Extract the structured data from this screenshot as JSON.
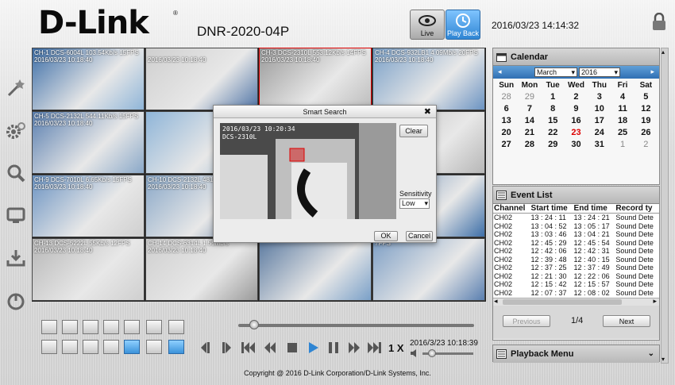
{
  "header": {
    "logo": "D-Link",
    "model": "DNR-2020-04P",
    "live_label": "Live",
    "playback_label": "Play Back",
    "datetime": "2016/03/23 14:14:32"
  },
  "cameras": [
    {
      "caption": "CH-1 DCS-6004L 103.54Kb/s 15FPS",
      "date": "2016/03/23 10:18:40"
    },
    {
      "caption": "",
      "date": "2016/03/23 10:18:40"
    },
    {
      "caption": "CH-3 DCS-2310L 553.12Kb/s 14FPS",
      "date": "2016/03/23 10:18:40"
    },
    {
      "caption": "CH-4 DCS-932LB1 4.09Mb/s 20FPS",
      "date": "2016/03/23 10:18:40"
    },
    {
      "caption": "CH-5 DCS-2132L 544.11Kb/s 15FPS",
      "date": "2016/03/23 10:18:40"
    },
    {
      "caption": "",
      "date": ""
    },
    {
      "caption": "",
      "date": ""
    },
    {
      "caption": "Kb/s 15FPS",
      "date": ""
    },
    {
      "caption": "CH-9 DCS-7010L 6.65Kb/s 15FPS",
      "date": "2016/03/23 10:18:40"
    },
    {
      "caption": "CH-10 DCS-2132L 481.54Kb/s",
      "date": "2016/03/23 10:18:40"
    },
    {
      "caption": "",
      "date": ""
    },
    {
      "caption": "",
      "date": ""
    },
    {
      "caption": "CH-13 DCS-5222L 55Kb/s 12FPS",
      "date": "2016/03/23 10:18:40"
    },
    {
      "caption": "CH-14 DCS-6314L 1.55Mb/s",
      "date": "2016/03/23 10:18:40"
    },
    {
      "caption": "",
      "date": ""
    },
    {
      "caption": "7FPS",
      "date": ""
    }
  ],
  "dialog": {
    "title": "Smart Search",
    "close": "✖",
    "preview_date": "2016/03/23 10:20:34",
    "preview_cam": "DCS-2310L",
    "clear": "Clear",
    "sensitivity_label": "Sensitivity",
    "sensitivity_value": "Low",
    "ok": "OK",
    "cancel": "Cancel"
  },
  "calendar": {
    "title": "Calendar",
    "month": "March",
    "year": "2016",
    "weekdays": [
      "Sun",
      "Mon",
      "Tue",
      "Wed",
      "Thu",
      "Fri",
      "Sat"
    ],
    "days": [
      {
        "d": "28",
        "other": true
      },
      {
        "d": "29",
        "other": true
      },
      {
        "d": "1"
      },
      {
        "d": "2"
      },
      {
        "d": "3"
      },
      {
        "d": "4"
      },
      {
        "d": "5"
      },
      {
        "d": "6"
      },
      {
        "d": "7"
      },
      {
        "d": "8"
      },
      {
        "d": "9"
      },
      {
        "d": "10"
      },
      {
        "d": "11"
      },
      {
        "d": "12"
      },
      {
        "d": "13"
      },
      {
        "d": "14"
      },
      {
        "d": "15"
      },
      {
        "d": "16"
      },
      {
        "d": "17"
      },
      {
        "d": "18"
      },
      {
        "d": "19"
      },
      {
        "d": "20"
      },
      {
        "d": "21"
      },
      {
        "d": "22"
      },
      {
        "d": "23",
        "today": true
      },
      {
        "d": "24"
      },
      {
        "d": "25"
      },
      {
        "d": "26"
      },
      {
        "d": "27"
      },
      {
        "d": "28"
      },
      {
        "d": "29"
      },
      {
        "d": "30"
      },
      {
        "d": "31"
      },
      {
        "d": "1",
        "other": true
      },
      {
        "d": "2",
        "other": true
      }
    ]
  },
  "events": {
    "title": "Event List",
    "columns": [
      "Channel",
      "Start time",
      "End time",
      "Record ty"
    ],
    "rows": [
      [
        "CH02",
        "13 : 24 : 11",
        "13 : 24 : 21",
        "Sound Dete"
      ],
      [
        "CH02",
        "13 : 04 : 52",
        "13 : 05 : 17",
        "Sound Dete"
      ],
      [
        "CH02",
        "13 : 03 : 46",
        "13 : 04 : 21",
        "Sound Dete"
      ],
      [
        "CH02",
        "12 : 45 : 29",
        "12 : 45 : 54",
        "Sound Dete"
      ],
      [
        "CH02",
        "12 : 42 : 06",
        "12 : 42 : 31",
        "Sound Dete"
      ],
      [
        "CH02",
        "12 : 39 : 48",
        "12 : 40 : 15",
        "Sound Dete"
      ],
      [
        "CH02",
        "12 : 37 : 25",
        "12 : 37 : 49",
        "Sound Dete"
      ],
      [
        "CH02",
        "12 : 21 : 30",
        "12 : 22 : 06",
        "Sound Dete"
      ],
      [
        "CH02",
        "12 : 15 : 42",
        "12 : 15 : 57",
        "Sound Dete"
      ],
      [
        "CH02",
        "12 : 07 : 37",
        "12 : 08 : 02",
        "Sound Dete"
      ]
    ],
    "previous": "Previous",
    "page": "1/4",
    "next": "Next"
  },
  "playback_menu": {
    "title": "Playback Menu"
  },
  "playback": {
    "speed": "1 X",
    "date": "2016/3/23",
    "time": "10:18:39"
  },
  "footer": {
    "copyright": "Copyright @ 2016 D-Link Corporation/D-Link Systems, Inc."
  },
  "colors": {
    "accent": "#2f85d3",
    "today": "#dd0000"
  }
}
